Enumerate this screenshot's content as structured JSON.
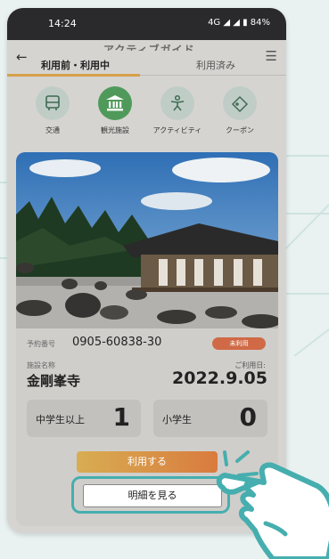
{
  "status_bar": {
    "time": "14:24",
    "system": "4G ◢ ◢ ▮ 84%"
  },
  "header": {
    "title_partial": "アクティブガイド"
  },
  "tabs": [
    {
      "label": "利用前・利用中",
      "active": true
    },
    {
      "label": "利用済み",
      "active": false
    }
  ],
  "categories": [
    {
      "label": "交通",
      "icon": "bus-icon",
      "active": false
    },
    {
      "label": "観光施設",
      "icon": "temple-icon",
      "active": true
    },
    {
      "label": "アクティビティ",
      "icon": "person-activity-icon",
      "active": false
    },
    {
      "label": "クーポン",
      "icon": "coupon-ticket-icon",
      "active": false
    }
  ],
  "ticket": {
    "reservation_label": "予約番号",
    "reservation_number": "0905-60838-30",
    "status_badge": "未利用",
    "facility_label": "施設名称",
    "facility_name": "金剛峯寺",
    "use_date_label": "ご利用日:",
    "use_date": "2022.9.05",
    "counts": [
      {
        "label": "中学生以上",
        "value": "1"
      },
      {
        "label": "小学生",
        "value": "0"
      }
    ],
    "use_button": "利用する",
    "detail_button": "明細を見る"
  },
  "colors": {
    "accent_green": "#4f9a5a",
    "tab_underline": "#d6a04a",
    "badge": "#d06a46",
    "highlight_teal": "#46aeae"
  }
}
